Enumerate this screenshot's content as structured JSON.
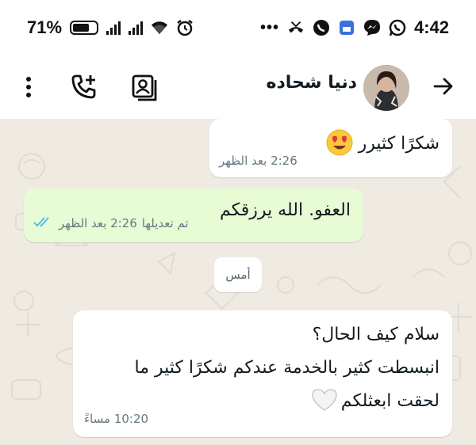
{
  "status_bar": {
    "battery": "71%",
    "time": "4:42"
  },
  "header": {
    "contact_name": "دنيا شحاده"
  },
  "messages": [
    {
      "direction": "in",
      "text": "شكرًا كثيرر",
      "emoji": "heart-eyes",
      "time": "2:26 بعد الظهر"
    },
    {
      "direction": "out",
      "text": "العفو. الله يرزقكم",
      "edited_label": "تم تعديلها",
      "time": "2:26 بعد الظهر",
      "status": "read"
    },
    {
      "direction": "in",
      "lines": [
        "سلام كيف الحال؟",
        "انبسطت كثير بالخدمة عندكم شكرًا كثير ما",
        "لحقت ابعثلكم"
      ],
      "emoji": "white-heart",
      "time": "10:20 مساءً"
    }
  ],
  "date_divider": "أمس",
  "colors": {
    "wallpaper": "#efeae2",
    "outgoing_bubble": "#e7fcd5",
    "incoming_bubble": "#ffffff",
    "read_ticks": "#53bdeb"
  }
}
